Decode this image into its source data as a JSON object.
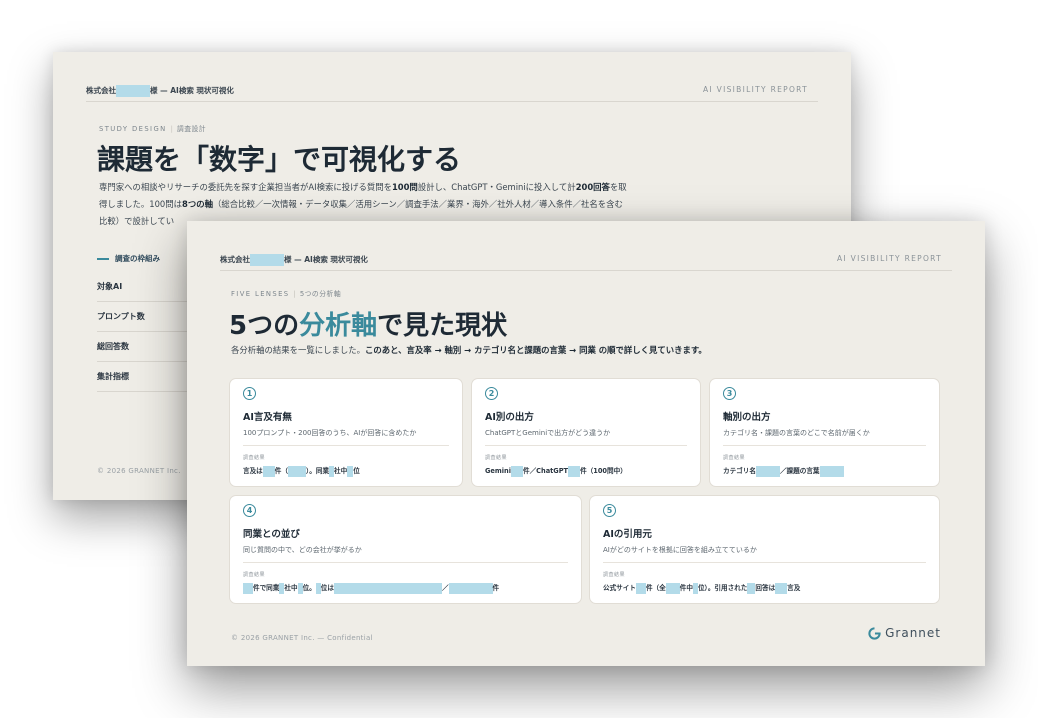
{
  "back_slide": {
    "header_left": "株式会社",
    "header_left_suffix": "様 — AI検索 現状可視化",
    "header_right": "AI VISIBILITY REPORT",
    "eyebrow_en": "STUDY DESIGN",
    "eyebrow_ja": "調査設計",
    "title": "課題を「数字」で可視化する",
    "desc_1a": "専門家への相談やリサーチの委託先を探す企業担当者がAI検索に投げる質問を",
    "desc_1b": "100問",
    "desc_1c": "設計し、ChatGPT・Geminiに投入して計",
    "desc_1d": "200回答",
    "desc_1e": "を取",
    "desc_2a": "得しました。100問は",
    "desc_2b": "8つの軸",
    "desc_2c": "（総合比較／一次情報・データ収集／活用シーン／調査手法／業界・海外／社外人材／導入条件／社名を含む",
    "desc_3": "比較）で設計してい",
    "frame_label": "調査の枠組み",
    "frame_rows": [
      "対象AI",
      "プロンプト数",
      "総回答数",
      "集計指標"
    ],
    "copyright": "© 2026 GRANNET Inc."
  },
  "front_slide": {
    "header_left": "株式会社",
    "header_left_suffix": "様 — AI検索 現状可視化",
    "header_right": "AI VISIBILITY REPORT",
    "eyebrow_en": "FIVE LENSES",
    "eyebrow_ja": "5つの分析軸",
    "title_a": "5つの",
    "title_accent": "分析軸",
    "title_b": "で見た現状",
    "desc_a": "各分析軸の結果を一覧にしました。",
    "desc_b": "このあと、言及率 → 軸別 → カテゴリ名と課題の言葉 → 同業 の順で詳しく見ていきます。",
    "result_label": "調査結果",
    "cards": [
      {
        "num": "1",
        "title": "AI言及有無",
        "sub": "100プロンプト・200回答のうち、AIが回答に含めたか"
      },
      {
        "num": "2",
        "title": "AI別の出方",
        "sub": "ChatGPTとGeminiで出方がどう違うか"
      },
      {
        "num": "3",
        "title": "軸別の出方",
        "sub": "カテゴリ名・課題の言葉のどこで名前が届くか"
      },
      {
        "num": "4",
        "title": "同業との並び",
        "sub": "同じ質問の中で、どの会社が挙がるか"
      },
      {
        "num": "5",
        "title": "AIの引用元",
        "sub": "AIがどのサイトを根拠に回答を組み立てているか"
      }
    ],
    "r1": {
      "a": "言及は",
      "b": "件（",
      "c": "）。同業",
      "d": "社中",
      "e": "位"
    },
    "r2": {
      "a": "Gemini",
      "b": "件／ChatGPT",
      "c": "件（100問中）"
    },
    "r3": {
      "a": "カテゴリ名",
      "b": "／課題の言葉"
    },
    "r4": {
      "a": "件で同業",
      "b": "社中",
      "c": "位。",
      "d": "位は",
      "e": "／",
      "f": "件"
    },
    "r5": {
      "a": "公式サイト",
      "b": "件（全",
      "c": "件中",
      "d": "位）。引用された",
      "e": "回答は",
      "f": "言及"
    },
    "copyright": "© 2026 GRANNET Inc. — Confidential",
    "logo": "Grannet"
  },
  "colors": {
    "accent": "#3a8a9c",
    "redaction": "#b3dbe9",
    "slide_bg": "#efede7"
  }
}
